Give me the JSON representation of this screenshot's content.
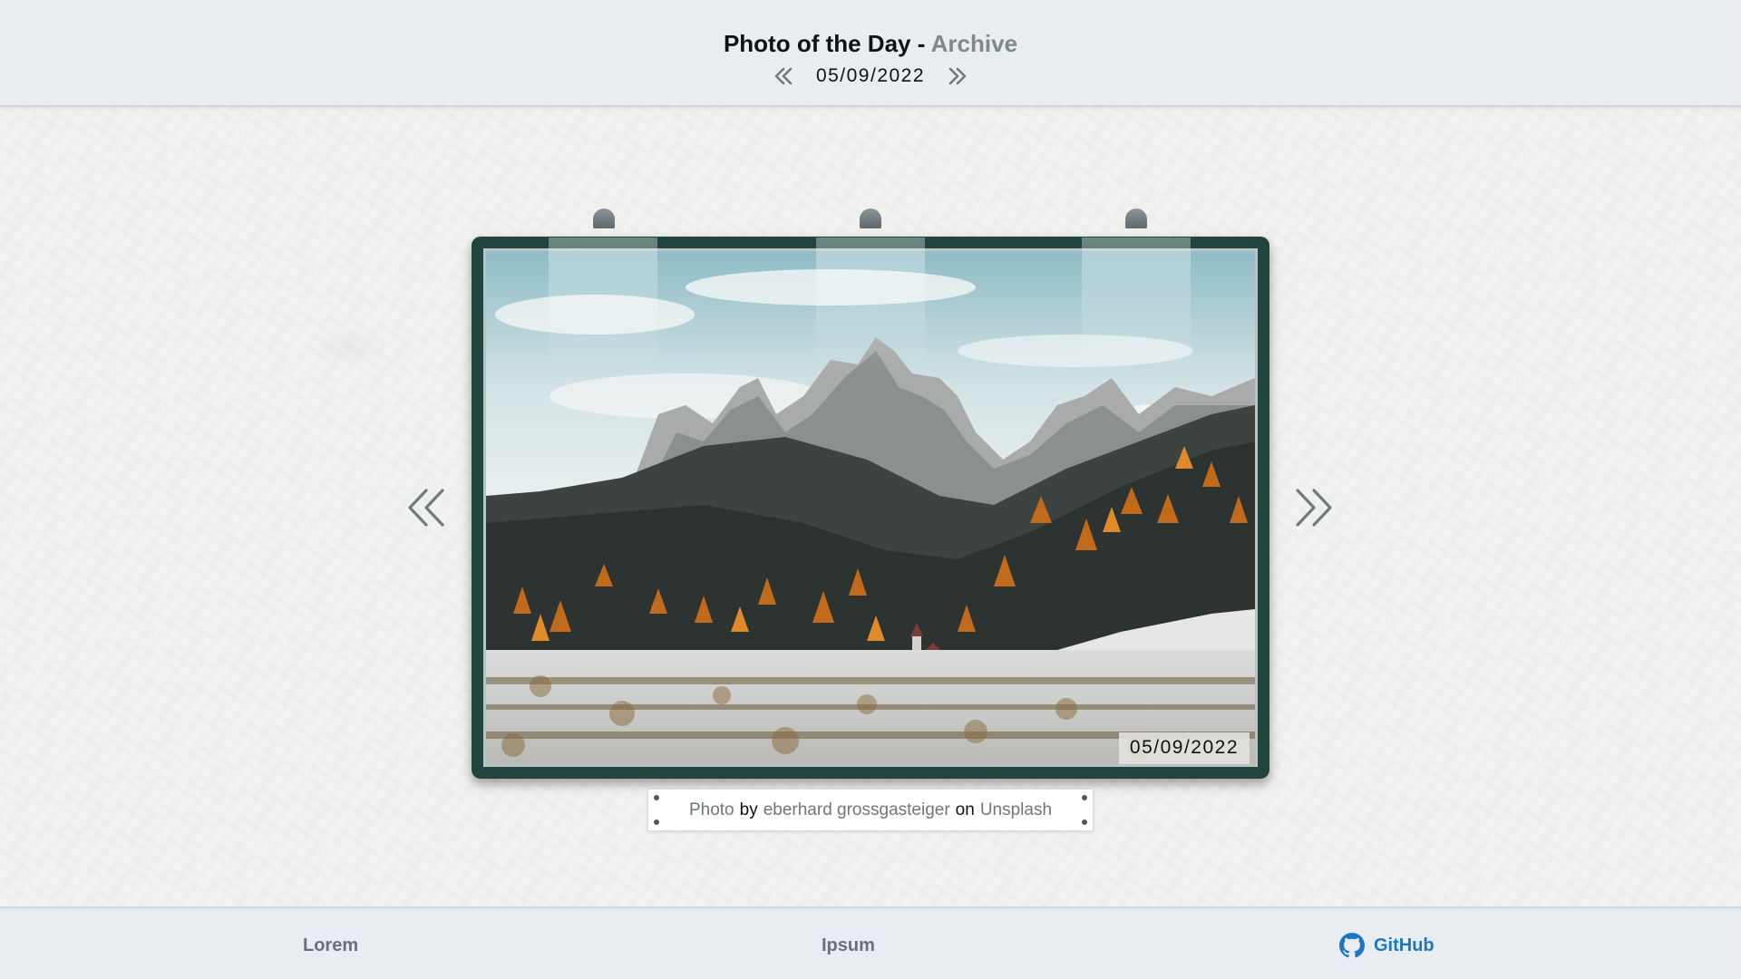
{
  "header": {
    "title_main": "Photo of the Day - ",
    "title_accent": "Archive",
    "date": "05/09/2022",
    "prev_icon": "double-chevron-left-icon",
    "next_icon": "double-chevron-right-icon"
  },
  "photo": {
    "date_overlay": "05/09/2022",
    "subject": "mountain landscape with church",
    "frame_color": "#22443f"
  },
  "caption": {
    "photo_link": "Photo",
    "by": "by",
    "author_link": "eberhard grossgasteiger",
    "on": "on",
    "site_link": "Unsplash"
  },
  "footer": {
    "item1": "Lorem",
    "item2": "Ipsum",
    "github_label": "GitHub",
    "github_icon": "github-icon"
  },
  "colors": {
    "accent_grey": "#7d8a87",
    "link_blue": "#1e75c2",
    "bar_bg": "#e9edf2"
  }
}
